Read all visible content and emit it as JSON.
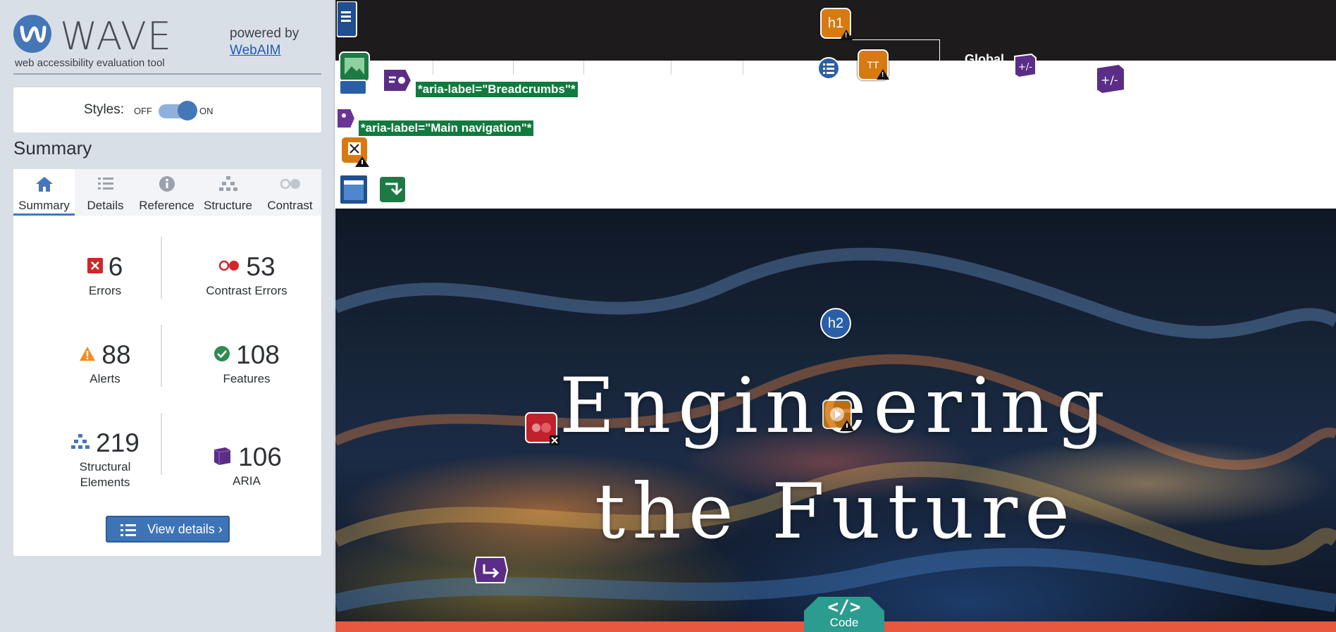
{
  "wave": {
    "logo": "WAVE",
    "tagline": "web accessibility evaluation tool",
    "powered_by": "powered by",
    "webaim": "WebAIM",
    "styles_label": "Styles:",
    "styles_off": "OFF",
    "styles_on": "ON",
    "summary_heading": "Summary",
    "tabs": [
      {
        "label": "Summary",
        "icon": "home-icon"
      },
      {
        "label": "Details",
        "icon": "list-icon"
      },
      {
        "label": "Reference",
        "icon": "info-icon"
      },
      {
        "label": "Structure",
        "icon": "hierarchy-icon"
      },
      {
        "label": "Contrast",
        "icon": "contrast-icon"
      }
    ],
    "stats": {
      "errors": {
        "count": "6",
        "label": "Errors",
        "color": "#d0272c"
      },
      "contrast_errors": {
        "count": "53",
        "label": "Contrast Errors",
        "color": "#d0272c"
      },
      "alerts": {
        "count": "88",
        "label": "Alerts",
        "color": "#ef8d1f"
      },
      "features": {
        "count": "108",
        "label": "Features",
        "color": "#2e8b4f"
      },
      "structural": {
        "count": "219",
        "label_1": "Structural",
        "label_2": "Elements",
        "color": "#4577b8"
      },
      "aria": {
        "count": "106",
        "label": "ARIA",
        "color": "#5b2d86"
      }
    },
    "view_details": "View details ›"
  },
  "page": {
    "nav_global": "Global",
    "aria_breadcrumbs": "*aria-label=\"Breadcrumbs\"*",
    "aria_main_nav": "*aria-label=\"Main navigation\"*",
    "h1_badge": "h1",
    "h2_badge": "h2",
    "text_size_badge": "TT",
    "expand_badge": "+/−",
    "hero_line1": "Engineering",
    "hero_line2": "the Future",
    "code_glyph": "</>",
    "code_label": "Code"
  }
}
